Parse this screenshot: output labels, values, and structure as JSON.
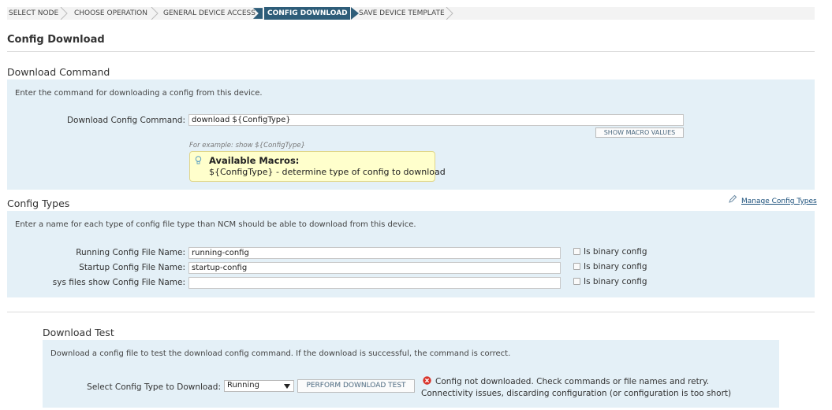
{
  "wizard": {
    "steps": [
      {
        "label": "SELECT NODE"
      },
      {
        "label": "CHOOSE OPERATION"
      },
      {
        "label": "GENERAL DEVICE ACCESS"
      },
      {
        "label": "CONFIG DOWNLOAD"
      },
      {
        "label": "SAVE DEVICE TEMPLATE"
      }
    ],
    "active_color": "#2e5d79"
  },
  "page_title": "Config Download",
  "download_command": {
    "heading": "Download Command",
    "description": "Enter the command for downloading a config from this device.",
    "command_label": "Download Config Command:",
    "command_value": "download ${ConfigType}",
    "show_macro_button": "SHOW MACRO VALUES",
    "example": "For example: show ${ConfigType}",
    "macros": {
      "title": "Available Macros:",
      "body": "${ConfigType} - determine type of config to download",
      "icon": "lightbulb-icon"
    }
  },
  "config_types": {
    "heading": "Config Types",
    "manage_link": "Manage Config Types",
    "manage_icon": "pencil-icon",
    "description": "Enter a name for each type of config file type than NCM should be able to download from this device.",
    "rows": [
      {
        "label": "Running Config File Name:",
        "value": "running-config",
        "binary_label": "Is binary config",
        "checked": false
      },
      {
        "label": "Startup Config File Name:",
        "value": "startup-config",
        "binary_label": "Is binary config",
        "checked": false
      },
      {
        "label": "sys files show Config File Name:",
        "value": "",
        "binary_label": "Is binary config",
        "checked": false
      }
    ]
  },
  "download_test": {
    "heading": "Download Test",
    "description": "Download a config file to test the download config command. If the download is successful, the command is correct.",
    "select_label": "Select Config Type to Download:",
    "select_value": "Running",
    "perform_button": "PERFORM DOWNLOAD TEST",
    "error_icon": "error-icon",
    "error_line1": "Config not downloaded. Check commands or file names and retry.",
    "error_line2": "Connectivity issues, discarding configuration (or configuration is too short)"
  }
}
